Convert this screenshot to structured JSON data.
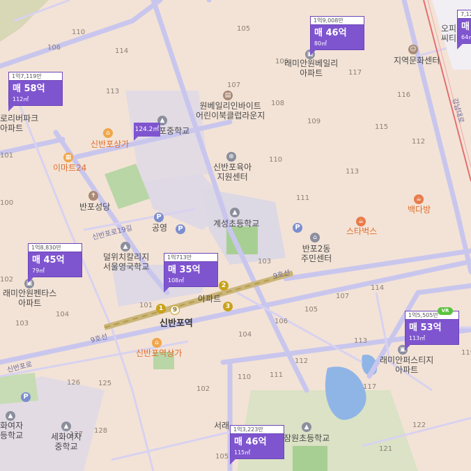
{
  "map": {
    "block_numbers": [
      "110",
      "106",
      "114",
      "113",
      "101",
      "102",
      "105",
      "106",
      "107",
      "108",
      "109",
      "117",
      "116",
      "115",
      "113",
      "111",
      "110",
      "112",
      "103",
      "104",
      "100",
      "102",
      "103",
      "101",
      "104",
      "106",
      "105",
      "107",
      "114",
      "113",
      "112",
      "111",
      "110",
      "126",
      "125",
      "127",
      "128",
      "117",
      "122",
      "121",
      "119",
      "105",
      "104",
      "103",
      "102",
      "101"
    ],
    "buildings": {
      "raemian_bailey": "래미안원베일리\n아파트",
      "wonbaily_kids": "원베일리인바이트\n어린이북클럽라운지",
      "banpo_culture": "지역문화센터",
      "officetel": "오피\n씨티",
      "sinban_mall": "신반포상가",
      "emart": "이마트24",
      "banpo_church": "반포성당",
      "sinban_welfare": "신반포육아\n지원센터",
      "gyesung_school": "계성초등학교",
      "dulwich": "덜위치칼리지\n서울영국학교",
      "gongyeong": "공영",
      "banpo2_center": "반포2동\n주민센터",
      "starbucks": "스타벅스",
      "paik": "백다방",
      "raemian_pentas": "래미안원펜타스\n아파트",
      "sinbanpo_station": "신반포역",
      "sinbanpo_mall2": "신반포역상가",
      "raemian_first": "래미안퍼스티지\n아파트",
      "sehwa_girls": "세화여자\n중학교",
      "sehwa_girls2": "화여자\n등학교",
      "jamwon_school": "잠원초등학교",
      "seorae": "서래",
      "banpo_middle": "포중학교",
      "riverpark": "로리버파크\n아파트",
      "apt_partial": "아파트"
    },
    "roads": {
      "sinbanpo_19": "신반포로19길",
      "line9": "9호선",
      "line9b": "9호선",
      "sinbanpo_ro": "신반포로",
      "gangnam_daero": "강남대로"
    },
    "listings": [
      {
        "header": "1억7,119만",
        "price": "매 58억",
        "area": "112㎡"
      },
      {
        "header": "1억9,008만",
        "price": "매 46억",
        "area": "80㎡"
      },
      {
        "header": "1억8,830만",
        "price": "매 45억",
        "area": "79㎡"
      },
      {
        "header": "1억713만",
        "price": "매 35억",
        "area": "108㎡"
      },
      {
        "header": "1억5,505만",
        "price": "매 53억",
        "area": "113㎡"
      },
      {
        "header": "1억3,223만",
        "price": "매 46억",
        "area": "115㎡"
      },
      {
        "header": "7,12",
        "price": "매",
        "area": "64㎡"
      }
    ],
    "area_chip": "124.2㎡",
    "vr_badge": "VR",
    "subway": {
      "line3": "3",
      "line2": "2",
      "line1": "1",
      "line9": "9"
    },
    "colors": {
      "listing": "#7f55cf",
      "land": "#f3e3d6",
      "road": "#c9c6ee",
      "park": "#b9d6a6",
      "water": "#8fb5e6"
    }
  }
}
